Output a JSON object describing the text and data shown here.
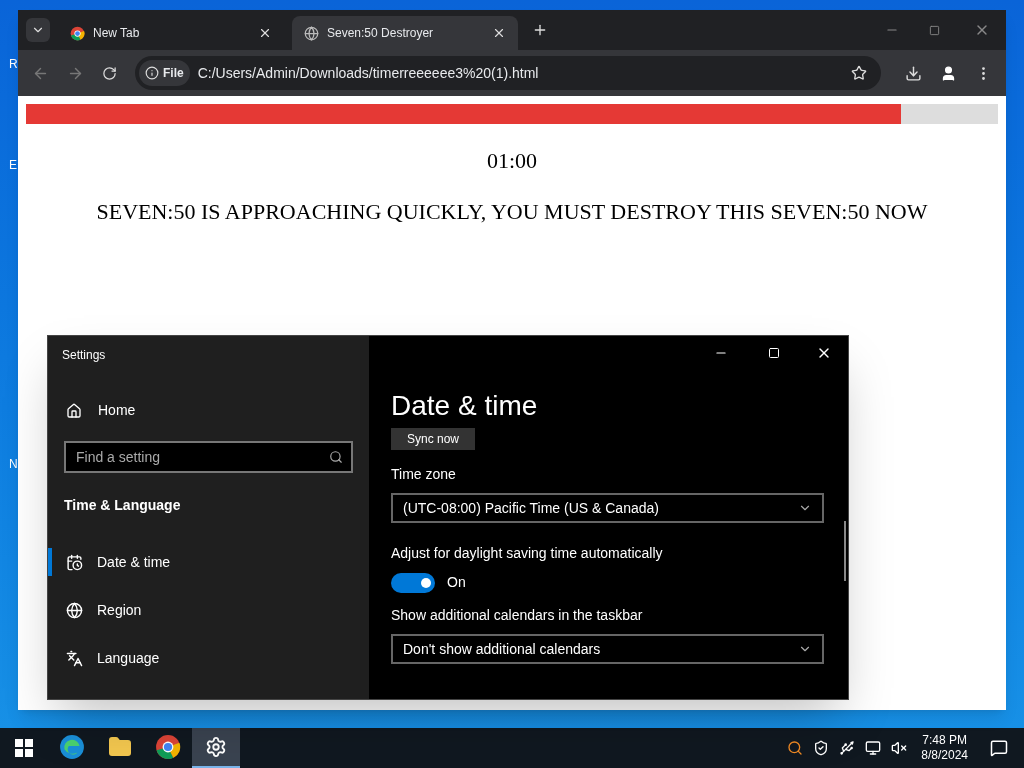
{
  "desktop_icon_labels": [
    "R",
    "E",
    "N"
  ],
  "browser": {
    "tabs": [
      {
        "title": "New Tab",
        "selected": false,
        "kind": "newtab"
      },
      {
        "title": "Seven:50 Destroyer",
        "selected": true,
        "kind": "page"
      }
    ],
    "address": {
      "badge": "File",
      "url": "C:/Users/Admin/Downloads/timerreeeeee3%20(1).html"
    },
    "page": {
      "progress": {
        "level": 0.9
      },
      "timer": "01:00",
      "message": "SEVEN:50 IS APPROACHING QUICKLY, YOU MUST DESTROY THIS SEVEN:50 NOW"
    }
  },
  "settings": {
    "title": "Settings",
    "home": "Home",
    "search": {
      "placeholder": "Find a setting"
    },
    "section": "Time & Language",
    "nav": [
      {
        "label": "Date & time",
        "selected": true
      },
      {
        "label": "Region",
        "selected": false
      },
      {
        "label": "Language",
        "selected": false
      }
    ],
    "heading": "Date & time",
    "sync_button": "Sync now",
    "time_zone": {
      "label": "Time zone",
      "value": "(UTC-08:00) Pacific Time (US & Canada)"
    },
    "daylight": {
      "label": "Adjust for daylight saving time automatically",
      "on": true,
      "state": "On"
    },
    "calendars": {
      "label": "Show additional calendars in the taskbar",
      "value": "Don't show additional calendars"
    }
  },
  "taskbar": {
    "apps": [
      {
        "selected": false
      },
      {
        "selected": false
      },
      {
        "selected": false
      },
      {
        "selected": true
      }
    ],
    "time": "7:48 PM",
    "date": "8/8/2024"
  }
}
